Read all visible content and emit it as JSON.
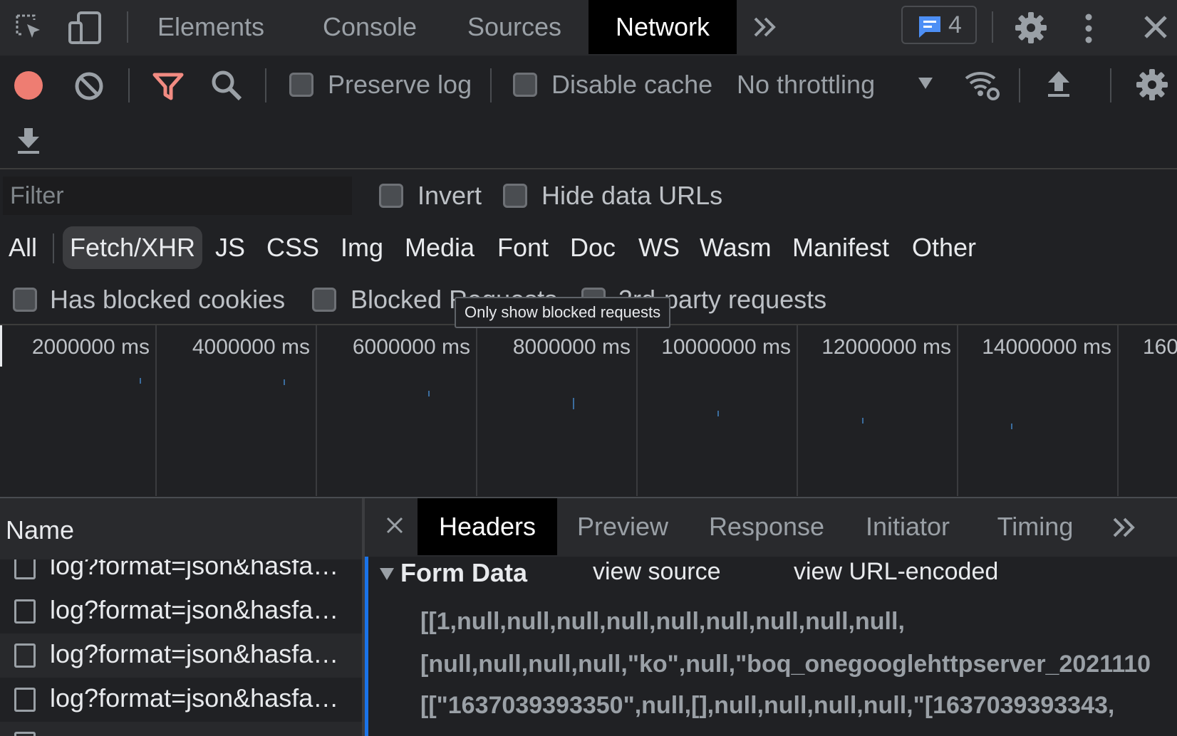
{
  "tabs": [
    "Elements",
    "Console",
    "Sources",
    "Network"
  ],
  "issues_count": "4",
  "toolbar": {
    "preserve_log": "Preserve log",
    "disable_cache": "Disable cache",
    "throttling": "No throttling"
  },
  "filter": {
    "placeholder": "Filter",
    "invert": "Invert",
    "hide_data_urls": "Hide data URLs"
  },
  "types": [
    "All",
    "Fetch/XHR",
    "JS",
    "CSS",
    "Img",
    "Media",
    "Font",
    "Doc",
    "WS",
    "Wasm",
    "Manifest",
    "Other"
  ],
  "active_type": "Fetch/XHR",
  "blocked": {
    "has_blocked_cookies": "Has blocked cookies",
    "blocked_requests": "Blocked Requests",
    "third_party": "3rd-party requests",
    "tooltip": "Only show blocked requests"
  },
  "overview": {
    "ticks": [
      "2000000 ms",
      "4000000 ms",
      "6000000 ms",
      "8000000 ms",
      "10000000 ms",
      "12000000 ms",
      "14000000 ms",
      "160"
    ]
  },
  "requests": {
    "header": "Name",
    "rows": [
      "log?format=json&hasfa…",
      "log?format=json&hasfa…",
      "log?format=json&hasfa…",
      "log?format=json&hasfa…"
    ]
  },
  "details": {
    "tabs": [
      "Headers",
      "Preview",
      "Response",
      "Initiator",
      "Timing"
    ],
    "form_data": {
      "title": "Form Data",
      "view_source": "view source",
      "view_url_encoded": "view URL-encoded",
      "lines": [
        "[[1,null,null,null,null,null,null,null,null,null,",
        "[null,null,null,null,\"ko\",null,\"boq_onegooglehttpserver_2021110",
        "[[\"1637039393350\",null,[],null,null,null,null,\"[1637039393343,"
      ]
    }
  },
  "colors": {
    "record": "#ee7d72",
    "filter_icon": "#f28b82",
    "issues_icon": "#4d8ff5",
    "accent_blue": "#1a73e8"
  }
}
